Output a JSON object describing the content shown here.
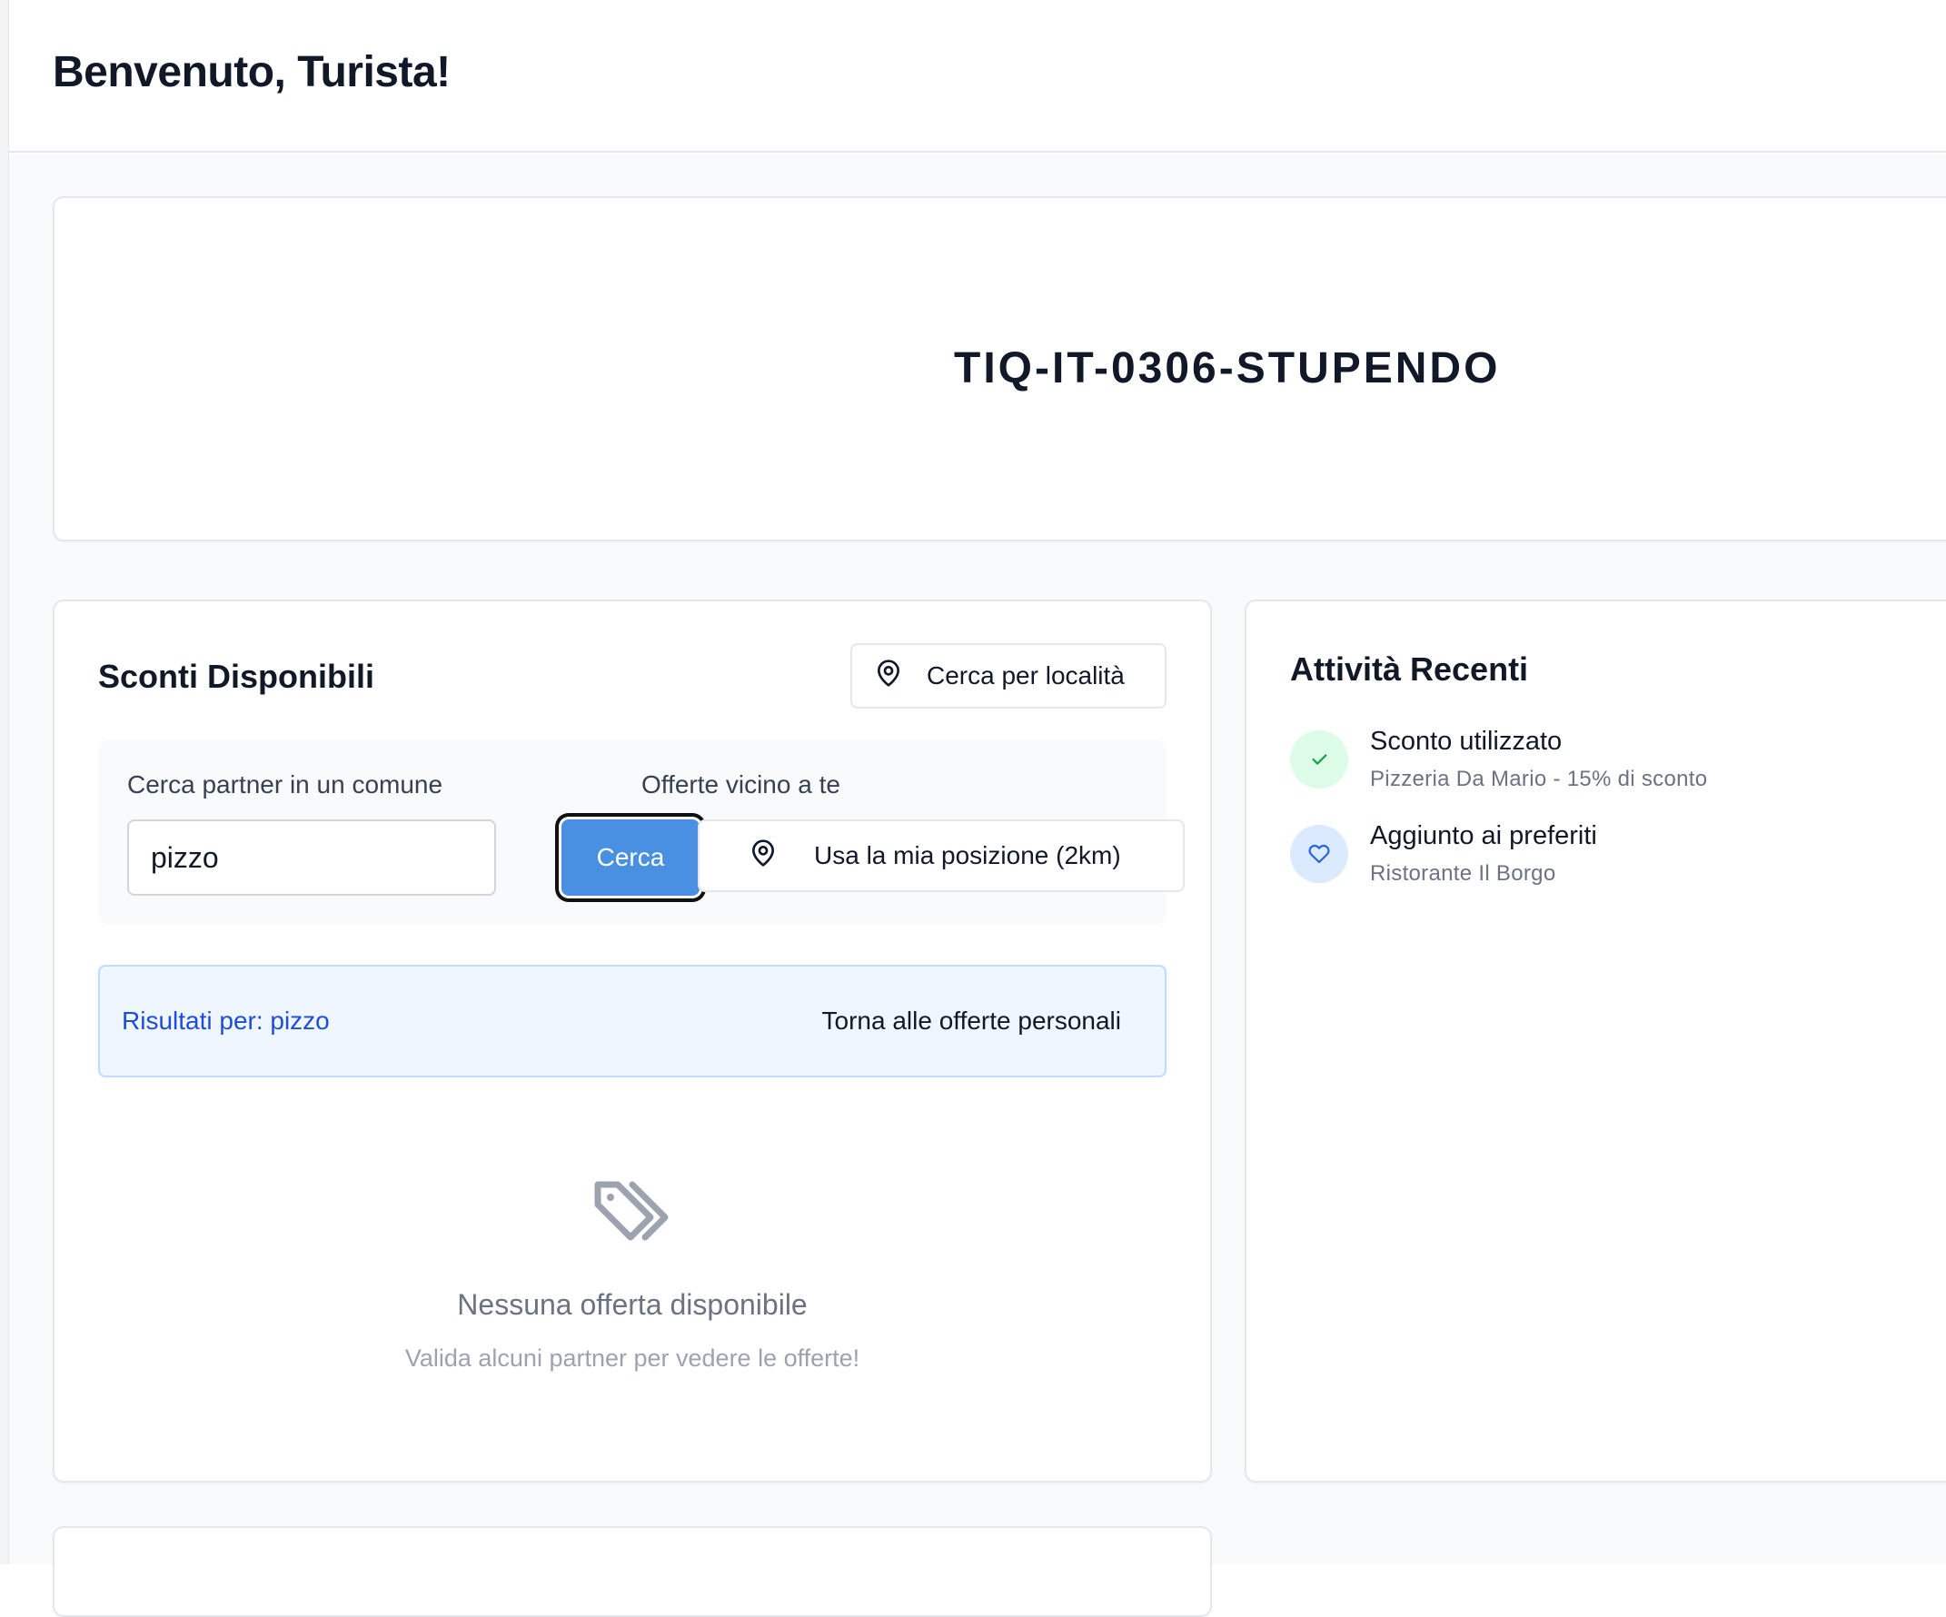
{
  "header": {
    "title": "Benvenuto, Turista!"
  },
  "code_card": {
    "code": "TIQ-IT-0306-STUPENDO"
  },
  "discounts": {
    "title": "Sconti Disponibili",
    "location_button_label": "Cerca per località",
    "location_button_icon": "map-pin-icon",
    "search_label": "Cerca partner in un comune",
    "search_value": "pizzo",
    "search_button_label": "Cerca",
    "nearby_label": "Offerte vicino a te",
    "nearby_button_label": "Usa la mia posizione (2km)",
    "nearby_button_icon": "map-pin-icon",
    "results_label": "Risultati per: pizzo",
    "back_button_label": "Torna alle offerte personali",
    "empty_icon": "tags-icon",
    "empty_title": "Nessuna offerta disponibile",
    "empty_subtitle": "Valida alcuni partner per vedere le offerte!"
  },
  "activity": {
    "title": "Attività Recenti",
    "items": [
      {
        "icon": "check-icon",
        "title": "Sconto utilizzato",
        "subtitle": "Pizzeria Da Mario - 15% di sconto",
        "icon_bg": "#dcfce7",
        "icon_color": "#16a34a"
      },
      {
        "icon": "heart-icon",
        "title": "Aggiunto ai preferiti",
        "subtitle": "Ristorante Il Borgo",
        "icon_bg": "#dbeafe",
        "icon_color": "#2563eb"
      }
    ]
  },
  "colors": {
    "primary_button": "#4a90e2",
    "results_text": "#1d4ed8"
  }
}
